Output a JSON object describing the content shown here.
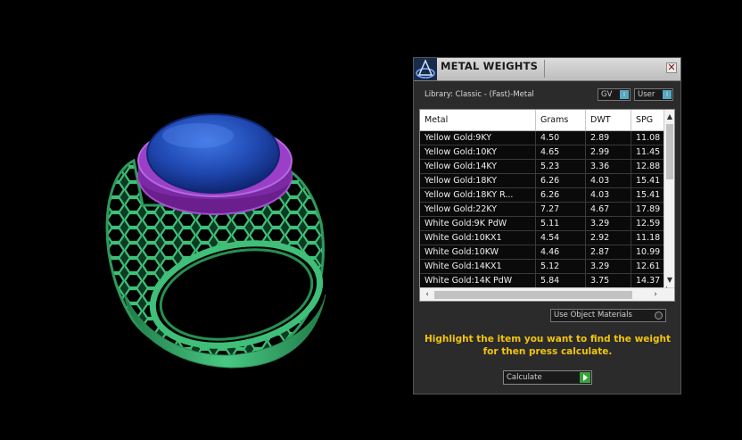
{
  "panel": {
    "title": "METAL WEIGHTS",
    "close_label": "✕",
    "library_label": "Library: Classic - (Fast)-Metal",
    "gv_label": "GV",
    "user_label": "User",
    "columns": [
      "Metal",
      "Grams",
      "DWT",
      "SPG"
    ],
    "rows": [
      [
        "Yellow Gold:9KY",
        "4.50",
        "2.89",
        "11.08"
      ],
      [
        "Yellow Gold:10KY",
        "4.65",
        "2.99",
        "11.45"
      ],
      [
        "Yellow Gold:14KY",
        "5.23",
        "3.36",
        "12.88"
      ],
      [
        "Yellow Gold:18KY",
        "6.26",
        "4.03",
        "15.41"
      ],
      [
        "Yellow Gold:18KY R...",
        "6.26",
        "4.03",
        "15.41"
      ],
      [
        "Yellow Gold:22KY",
        "7.27",
        "4.67",
        "17.89"
      ],
      [
        "White Gold:9K PdW",
        "5.11",
        "3.29",
        "12.59"
      ],
      [
        "White Gold:10KX1",
        "4.54",
        "2.92",
        "11.18"
      ],
      [
        "White Gold:10KW",
        "4.46",
        "2.87",
        "10.99"
      ],
      [
        "White Gold:14KX1",
        "5.12",
        "3.29",
        "12.61"
      ],
      [
        "White Gold:14K PdW",
        "5.84",
        "3.75",
        "14.37"
      ]
    ],
    "use_object_materials_label": "Use Object Materials",
    "hint_line1": "Highlight the item you want to find the weight",
    "hint_line2": "for then press calculate.",
    "calculate_label": "Calculate"
  },
  "colors": {
    "hint_text": "#f1c40f",
    "ring_band": "#2e9a5c",
    "bezel": "#8b2fb0",
    "stone": "#1f4fb0"
  },
  "icons": {
    "app_logo": "app-logo-icon",
    "close": "close-icon",
    "scroll_up": "chevron-up-icon",
    "scroll_down": "chevron-down-icon",
    "scroll_left": "chevron-left-icon",
    "scroll_right": "chevron-right-icon",
    "calculate_go": "play-icon"
  }
}
